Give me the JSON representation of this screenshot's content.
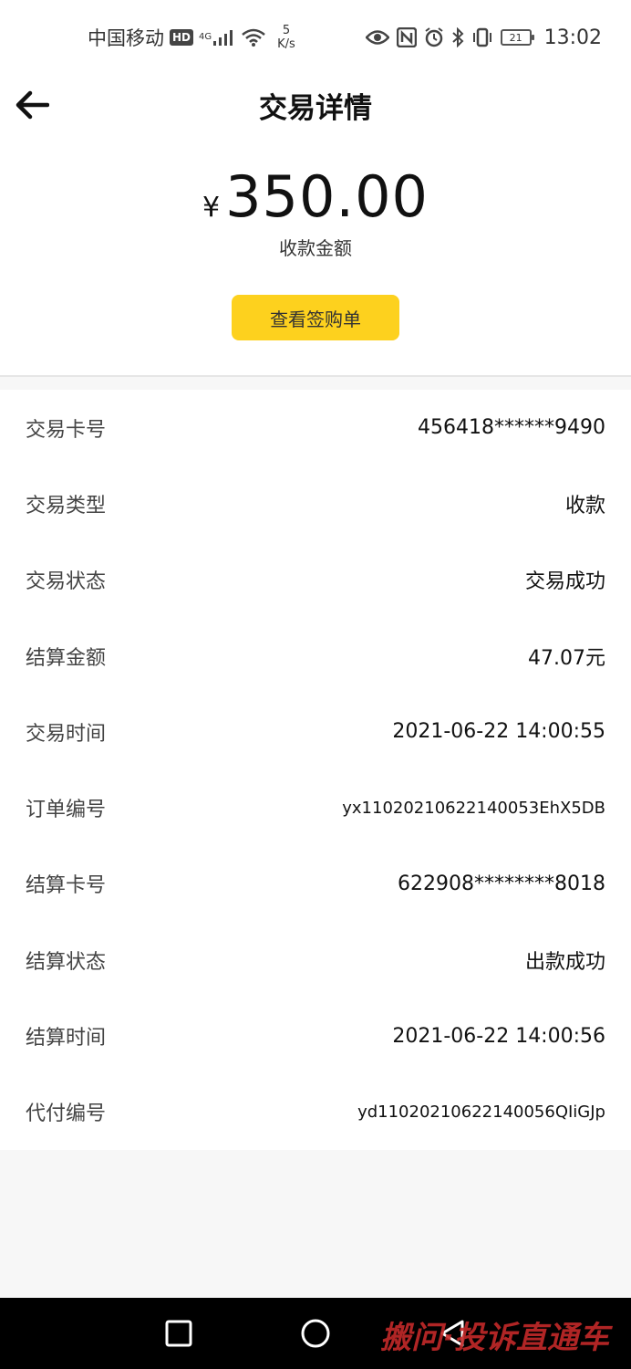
{
  "status_bar": {
    "carrier": "中国移动",
    "hd": "HD",
    "network": "4G",
    "speed_value": "5",
    "speed_unit": "K/s",
    "battery": "21",
    "time": "13:02"
  },
  "nav": {
    "title": "交易详情",
    "back_icon": "arrow-left-icon"
  },
  "summary": {
    "currency": "¥",
    "amount": "350.00",
    "amount_label": "收款金额",
    "receipt_button": "查看签购单",
    "button_color": "#fdd11e"
  },
  "details": [
    {
      "label": "交易卡号",
      "value": "456418******9490"
    },
    {
      "label": "交易类型",
      "value": "收款"
    },
    {
      "label": "交易状态",
      "value": "交易成功"
    },
    {
      "label": "结算金额",
      "value": "47.07元"
    },
    {
      "label": "交易时间",
      "value": "2021-06-22 14:00:55"
    },
    {
      "label": "订单编号",
      "value": "yx11020210622140053EhX5DB"
    },
    {
      "label": "结算卡号",
      "value": "622908********8018"
    },
    {
      "label": "结算状态",
      "value": "出款成功"
    },
    {
      "label": "结算时间",
      "value": "2021-06-22 14:00:56"
    },
    {
      "label": "代付编号",
      "value": "yd11020210622140056QIiGJp"
    }
  ],
  "watermark": "搬问·投诉直通车"
}
